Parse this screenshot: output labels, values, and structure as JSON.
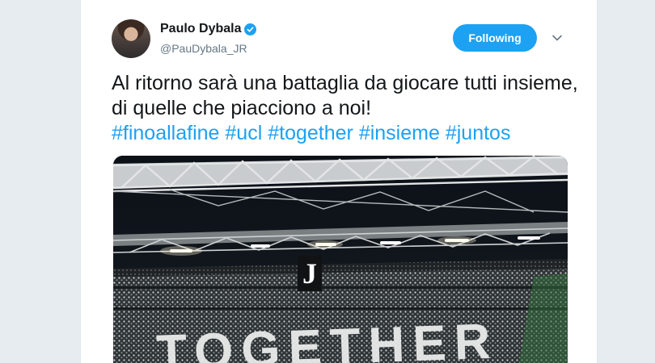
{
  "tweet": {
    "author_name": "Paulo Dybala",
    "handle": "@PauDybala_JR",
    "follow_label": "Following",
    "text": "Al ritorno sarà una battaglia da giocare tutti insieme, di quelle che piacciono a noi!",
    "hashtags": [
      "#finoallafine",
      "#ucl",
      "#together",
      "#insieme",
      "#juntos"
    ],
    "media": {
      "banner_text": "TOGETHER",
      "logo_letter": "J"
    }
  },
  "colors": {
    "accent": "#1da1f2",
    "text": "#14171a",
    "muted": "#657786",
    "background": "#e6ecf0"
  },
  "icons": [
    "verified-badge-icon",
    "chevron-down-icon"
  ]
}
